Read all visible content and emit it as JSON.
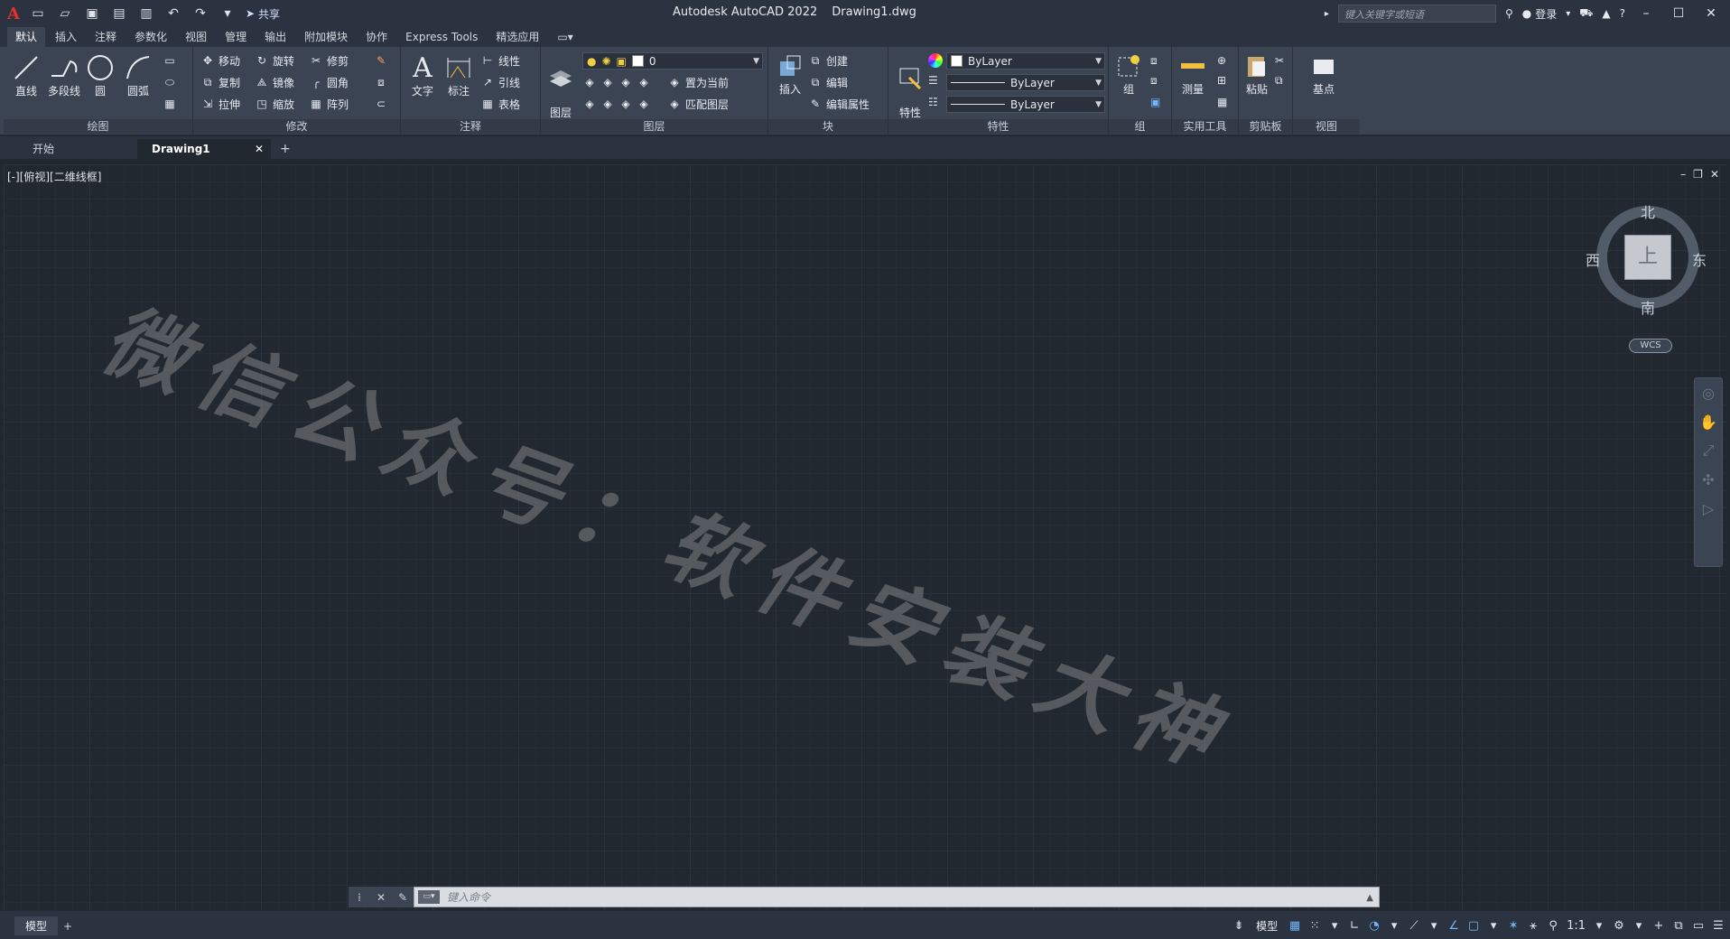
{
  "title": {
    "app": "Autodesk AutoCAD 2022",
    "file": "Drawing1.dwg",
    "logo": "A",
    "share": "共享",
    "search_placeholder": "键入关键字或短语",
    "login": "登录"
  },
  "ribbon_tabs": [
    "默认",
    "插入",
    "注释",
    "参数化",
    "视图",
    "管理",
    "输出",
    "附加模块",
    "协作",
    "Express Tools",
    "精选应用"
  ],
  "panels": {
    "draw": {
      "title": "绘图",
      "line": "直线",
      "polyline": "多段线",
      "circle": "圆",
      "arc": "圆弧"
    },
    "modify": {
      "title": "修改",
      "move": "移动",
      "rotate": "旋转",
      "trim": "修剪",
      "copy": "复制",
      "mirror": "镜像",
      "fillet": "圆角",
      "stretch": "拉伸",
      "scale": "缩放",
      "array": "阵列"
    },
    "annotation": {
      "title": "注释",
      "text": "文字",
      "dim": "标注",
      "linear": "线性",
      "leader": "引线",
      "table": "表格"
    },
    "layers": {
      "title": "图层",
      "props": "图层\n特性",
      "layer_value": "0",
      "set_current": "置为当前",
      "match_layer": "匹配图层"
    },
    "block": {
      "title": "块",
      "insert": "插入",
      "create": "创建",
      "edit": "编辑",
      "edit_attr": "编辑属性"
    },
    "properties": {
      "title": "特性",
      "match": "特性\n匹配",
      "color": "ByLayer",
      "linetype": "ByLayer",
      "lineweight": "ByLayer"
    },
    "groups": {
      "title": "组",
      "group": "组"
    },
    "utilities": {
      "title": "实用工具",
      "measure": "测量"
    },
    "clipboard": {
      "title": "剪贴板",
      "paste": "粘贴"
    },
    "view": {
      "title": "视图",
      "base": "基点"
    }
  },
  "doc_tabs": {
    "start": "开始",
    "drawing": "Drawing1"
  },
  "viewport": {
    "label": "[-][俯视][二维线框]"
  },
  "viewcube": {
    "north": "北",
    "south": "南",
    "east": "东",
    "west": "西",
    "face": "上",
    "wcs": "WCS"
  },
  "watermark": "微信公众号：软件安装大神",
  "command": {
    "placeholder": "键入命令"
  },
  "status": {
    "model_tab": "模型",
    "model_btn": "模型",
    "scale": "1:1"
  },
  "colors": {
    "accent": "#6fb6ff",
    "logo": "#e4302f",
    "canvas": "#212830"
  }
}
